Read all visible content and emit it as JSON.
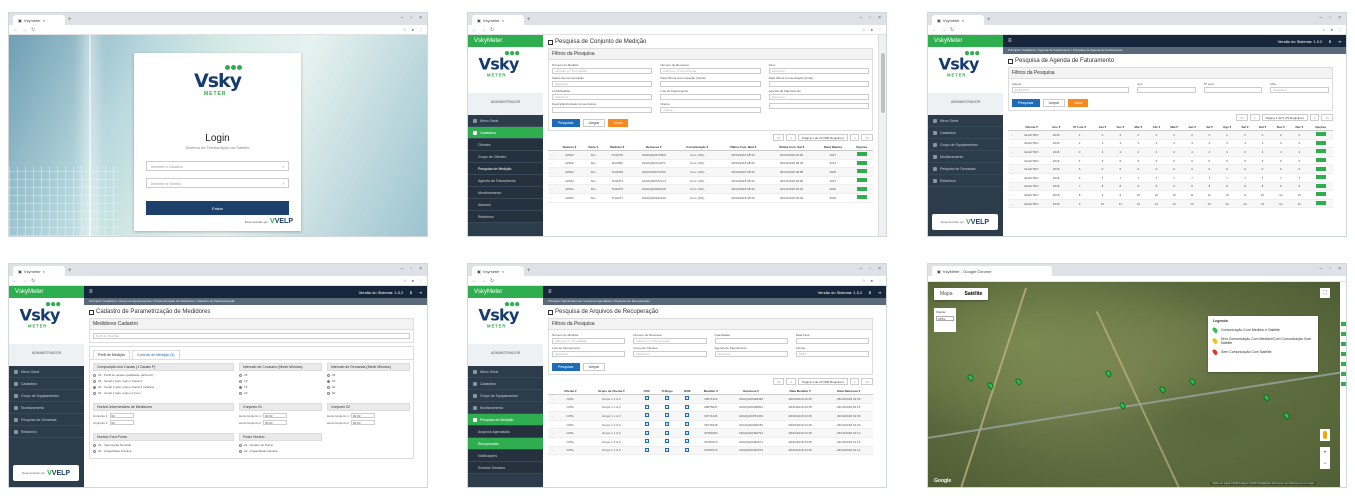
{
  "browser": {
    "tab_label": "Vsymeter",
    "map_tab_label": "VsyMeter - Google Chrome"
  },
  "brand": {
    "logo_text_v": "V",
    "logo_text_sky": "sky",
    "logo_meter": "METER",
    "side_title": "VskyMeter",
    "user_label": "ADMINISTRADOR",
    "developed_by": "Desenvolvido por",
    "velp": "VELP",
    "colors": {
      "green": "#2fae4f",
      "navy": "#1d3f6b",
      "sidebar": "#2d3c4b",
      "orange": "#f58a1f",
      "blue": "#1e6bb8"
    }
  },
  "login": {
    "title": "Login",
    "subtitle": "Sistema de Telemedição via Satélite",
    "user_placeholder": "Informe o Usuário",
    "pass_placeholder": "Informe a Senha",
    "button": "Entrar"
  },
  "topbar": {
    "version": "Versão do Sistema: 1.0.2"
  },
  "sidebar": {
    "s2": [
      "Menu Geral",
      "Cadastros",
      "Clientes",
      "Grupo de Clientes",
      "Pesquisa de Medição",
      "Agenda de Faturamento",
      "Monitoramento",
      "Alarmes",
      "Relatórios"
    ],
    "s3": [
      "Menu Geral",
      "Cadastros",
      "Grupo de Equipamentos",
      "Monitoramento",
      "Pesquisa de Demanda",
      "Relatórios"
    ],
    "s4": [
      "Menu Geral",
      "Cadastros",
      "Grupo de Equipamentos",
      "Monitoramento",
      "Pesquisa de Demanda",
      "Relatórios"
    ],
    "s5": [
      "Menu Geral",
      "Cadastros",
      "Grupo de Equipamentos",
      "Monitoramento",
      "Pesquisa de Medição",
      "Arquivos Agendados",
      "Recuperação",
      "Notificações",
      "Eventos Gerados"
    ]
  },
  "s2": {
    "title": "Pesquisa de Conjunto de Medição",
    "panel": "Filtros da Pesquisa",
    "fields": [
      "Número do Medidor",
      "Número de Remessa",
      "Ativo",
      "Status da Comunicação",
      "Data Última Comunicação (Inicial)",
      "Data Última Comunicação (Final)",
      "Linha/Satélite",
      "Lote de Faturamento",
      "Agenda de Faturamento",
      "Descrição/Unidade Consumidora",
      "Cliente",
      ""
    ],
    "placeholders": [
      "Informe o nº do medidor",
      "Informe o nº da remessa",
      "Selecione",
      "Selecione",
      "",
      "",
      "Selecione",
      "",
      "Selecione",
      "",
      "Cliente",
      ""
    ],
    "btn_search": "Pesquisar",
    "btn_clear": "Limpar",
    "btn_new": "Novo",
    "pager": "Página 1 de 20 (999 Registros)",
    "headers": [
      "",
      "Número ▾",
      "Série ▾",
      "Medidor ▾",
      "Remessa ▾",
      "Comunicação ▾",
      "Última Com. Med ▾",
      "Última Com. Sat ▾",
      "Nível Bateria",
      "Opções"
    ],
    "rows": [
      [
        "...",
        "22602",
        "Sim",
        "7102075",
        "0102Q200476829",
        "Com. (OK)",
        "30/10/2018 08:30",
        "30/10/2018 09:00",
        "4027",
        ""
      ],
      [
        "...",
        "22602",
        "Sim",
        "1102952",
        "0102Q200114271",
        "Com. (OK)",
        "30/10/2018 08:30",
        "30/10/2018 08:45",
        "4013",
        ""
      ],
      [
        "...",
        "22602",
        "Sim",
        "7102063",
        "0102V000071150",
        "Com. (OK)",
        "30/10/2018 08:30",
        "30/10/2018 08:58",
        "4025",
        ""
      ],
      [
        "...",
        "22602",
        "Sim",
        "7102071",
        "0102Q200472114",
        "Com. (OK)",
        "30/10/2018 08:30",
        "30/10/2018 09:00",
        "4027",
        ""
      ],
      [
        "...",
        "22602",
        "Sim",
        "7102073",
        "0102Q200499128",
        "Com. (OK)",
        "30/10/2018 08:30",
        "30/10/2018 09:02",
        "4026",
        ""
      ],
      [
        "...",
        "22602",
        "Sim",
        "7102077",
        "0102Q200194146",
        "Com. (OK)",
        "30/10/2018 08:30",
        "30/10/2018 09:04",
        "4026",
        ""
      ]
    ]
  },
  "s3": {
    "crumb": "Principal / Cadastros / Agenda de Faturamento / Pesquisa de Agenda de Faturamento",
    "title": "Pesquisa de Agenda de Faturamento",
    "panel": "Filtros da Pesquisa",
    "fields": [
      "Cliente",
      "Ano",
      "Nº Lote",
      "Mês"
    ],
    "placeholders": [
      "ELEKTRO",
      "",
      "",
      "Selecione"
    ],
    "btn_search": "Pesquisar",
    "btn_clear": "Limpar",
    "btn_new": "Novo",
    "pager": "Página 1 de 5 (75 Registros)",
    "headers": [
      "",
      "Cliente ▾",
      "Ano ▾",
      "Nº Lote ▾",
      "Jan ▾",
      "Fev ▾",
      "Mar ▾",
      "Abr ▾",
      "Mai ▾",
      "Jun ▾",
      "Jul ▾",
      "Ago ▾",
      "Set ▾",
      "Out ▾",
      "Nov ▾",
      "Dez ▾",
      "Opções"
    ],
    "rows": [
      [
        "...",
        "ELEKTRO",
        "2018",
        "1",
        "2",
        "2",
        "2",
        "2",
        "2",
        "2",
        "2",
        "2",
        "2",
        "2",
        "2",
        "2",
        ""
      ],
      [
        "...",
        "ELEKTRO",
        "2018",
        "2",
        "3",
        "3",
        "3",
        "3",
        "3",
        "3",
        "3",
        "3",
        "3",
        "3",
        "3",
        "3",
        ""
      ],
      [
        "...",
        "ELEKTRO",
        "2018",
        "3",
        "4",
        "4",
        "4",
        "4",
        "4",
        "4",
        "4",
        "4",
        "4",
        "4",
        "4",
        "4",
        ""
      ],
      [
        "...",
        "ELEKTRO",
        "2018",
        "4",
        "5",
        "5",
        "5",
        "5",
        "5",
        "5",
        "5",
        "5",
        "5",
        "5",
        "5",
        "5",
        ""
      ],
      [
        "...",
        "ELEKTRO",
        "2018",
        "5",
        "6",
        "6",
        "6",
        "6",
        "6",
        "6",
        "6",
        "6",
        "6",
        "6",
        "6",
        "6",
        ""
      ],
      [
        "...",
        "ELEKTRO",
        "2018",
        "6",
        "7",
        "7",
        "7",
        "7",
        "7",
        "7",
        "7",
        "7",
        "7",
        "7",
        "7",
        "7",
        ""
      ],
      [
        "...",
        "ELEKTRO",
        "2018",
        "7",
        "8",
        "8",
        "8",
        "8",
        "9",
        "8",
        "8",
        "8",
        "8",
        "8",
        "8",
        "8",
        ""
      ],
      [
        "...",
        "ELEKTRO",
        "2018",
        "8",
        "9",
        "9",
        "10",
        "10",
        "10",
        "11",
        "11",
        "10",
        "9",
        "10",
        "10",
        "10",
        ""
      ],
      [
        "...",
        "ELEKTRO",
        "2018",
        "9",
        "10",
        "11",
        "12",
        "12",
        "12",
        "12",
        "13",
        "12",
        "12",
        "13",
        "12",
        "12",
        ""
      ]
    ]
  },
  "s4": {
    "crumb": "Principal / Cadastros / Grupo de Equipamentos / Parametrização de Medidores / Cadastro de Parametrização",
    "title": "Cadastro de Parametrização de Medidores",
    "panel": "Medidores Cadastro",
    "field_placeholder": "Perfil de Medição",
    "tab_a": "Perfil de Medição",
    "tab_b": "Controle de Medição (5)",
    "col_a": "Composição dos Canais (1 Canais P)",
    "col_b": "Intervalo de Consumo (Medir Minutos)",
    "col_c": "Intervalo de Demanda (Medir Minutos)",
    "opts_a": [
      "01 - Perfil de canais (qualidade, tarifa etc)",
      "02 - Canal 1 (ativ, reat) e Canal 2",
      "03 - Canal 1 (ativ, reat) e Canal 2 (reativa)",
      "04 - Canal 1 (ativ, reat) e 2 (rev)"
    ],
    "opts_b": [
      "05",
      "10",
      "15",
      "30"
    ],
    "opts_c": [
      "05",
      "15",
      "30",
      "60"
    ],
    "sub_a": "Horário Intermediário de Medidores",
    "sub_b": "Conjunto 01",
    "sub_c": "Conjunto 02",
    "row_a": [
      "Conjunto 1",
      "Conjunto 2"
    ],
    "row_b": [
      "Hora Conjunto 1",
      "Hora Conjunto 2"
    ],
    "row_c": [
      "Hora Conjunto 1",
      "Hora Conjunto 2"
    ],
    "values_a": [
      "00",
      "00"
    ],
    "values_b": [
      "00:00",
      "00:00"
    ],
    "values_c": [
      "00:00",
      "00:00"
    ],
    "sub_d": "Horário Fora Ponta",
    "sub_e": "Posto Horário",
    "opt_d": [
      "01 - Interrupção Nominal",
      "02 - Capacidade Indutiva"
    ],
    "opt_e": [
      "01 - Horário de Ponta",
      "02 - Capacidade Indutiva"
    ]
  },
  "s5": {
    "crumb": "Principal / Monitoramento / Arquivos Agendados / Pesquisa de Recuperação",
    "title": "Pesquisa de Arquivos de Recuperação",
    "panel": "Filtros da Pesquisa",
    "fields": [
      "Número do Medidor",
      "Número de Remessa",
      "Quantidade",
      "Data Final",
      "Lote de Faturamento",
      "Grupo de Clientes",
      "Agenda de Faturamento",
      "Cliente"
    ],
    "placeholders": [
      "Informe o nº do medidor",
      "Informe o nº da remessa",
      "",
      "",
      "Selecione",
      "Selecione",
      "Selecione",
      "CPFL"
    ],
    "btn_search": "Pesquisar",
    "btn_clear": "Limpar",
    "pager": "Página 1 de 20 (999 Registros)",
    "headers": [
      "",
      "Cliente ▾",
      "Grupo de Cliente ▾",
      "CRC",
      "Tráfego",
      "BRE",
      "Medidor ▾",
      "Remessa ▾",
      "Data Medidor ▾",
      "Data Remessa ▾"
    ],
    "rows": [
      [
        "...",
        "CPFL",
        "Grupo 1 1 & 3",
        "",
        "",
        "",
        "29874416",
        "0102Q200498448",
        "28/10/2018 23:45",
        "28/10/2018 23:59"
      ],
      [
        "...",
        "CPFL",
        "Grupo 1 1 & 3",
        "",
        "",
        "",
        "29875847",
        "0102Q200498824",
        "28/10/2018 23:45",
        "29/10/2018 00:15"
      ],
      [
        "...",
        "CPFL",
        "Grupo 1 1 & 3",
        "",
        "",
        "",
        "30774446",
        "0102Q200784454",
        "28/10/2018 23:45",
        "29/10/2018 01:06"
      ],
      [
        "...",
        "CPFL",
        "Grupo 1 1 & 3",
        "",
        "",
        "",
        "30779448",
        "0102Q200499784",
        "28/10/2018 23:45",
        "29/10/2018 01:20"
      ],
      [
        "...",
        "CPFL",
        "Grupo 1 1 & 3",
        "",
        "",
        "",
        "30780490",
        "0102Q200490791",
        "28/10/2018 23:45",
        "29/10/2018 01:12"
      ],
      [
        "...",
        "CPFL",
        "Grupo 1 1 & 3",
        "",
        "",
        "",
        "30780470",
        "0102Q200490071",
        "28/10/2018 23:45",
        "29/10/2018 01:13"
      ],
      [
        "...",
        "CPFL",
        "Grupo 1 1 & 3",
        "",
        "",
        "",
        "30780470",
        "0102Q200490070",
        "28/10/2018 23:45",
        "29/10/2018 01:14"
      ]
    ]
  },
  "s6": {
    "map_tab": "Mapa",
    "sat_tab": "Satélite",
    "box_label": "Cliente:",
    "box_value": "CPFL",
    "legend_title": "Legenda:",
    "legend": [
      "Comunicação Com Medidor e Satélite",
      "Sem Comunicação Com Medidor/Com Comunicação Com Satélite",
      "Sem Comunicação Com Satélite"
    ],
    "google": "Google",
    "attribution": "Dados do mapa ©2018 Imagens ©2018 TerraMetrics  Termos de Uso  Informar erro no mapa"
  }
}
